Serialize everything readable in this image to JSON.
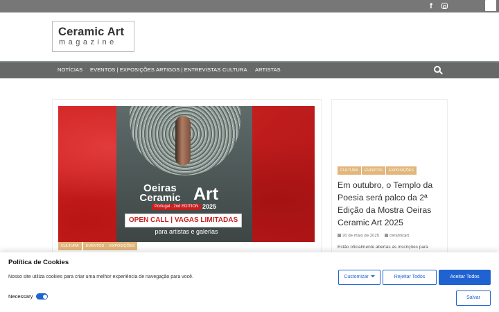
{
  "topbar": {
    "social": [
      "facebook-icon",
      "instagram-icon"
    ]
  },
  "logo": {
    "line1": "Ceramic Art",
    "line2": "magazine"
  },
  "nav": {
    "items": [
      "NOTÍCIAS",
      "EVENTOS | EXPOSIÇÕES",
      "ARTIGOS | ENTREVISTAS",
      "CULTURA",
      "ARTISTAS"
    ],
    "search_icon": "search-icon"
  },
  "hero": {
    "line1": "Oeiras",
    "line2": "Ceramic",
    "line3": "Art",
    "edition": "Portugal . 2nd EDITION",
    "year": "2025",
    "callout": "OPEN CALL | VAGAS LIMITADAS",
    "subline": "para artistas e galerias"
  },
  "main_tags": [
    "CULTURA",
    "EVENTOS",
    "EXPOSIÇÕES"
  ],
  "side_post": {
    "tags": [
      "CULTURA",
      "EVENTOS",
      "EXPOSIÇÕES"
    ],
    "title": "Em outubro, o Templo da Poesia será palco da 2ª Edição da Mostra Oeiras Ceramic Art 2025",
    "date": "30 de maio de 2025",
    "author": "ceramicart",
    "excerpt": "Estão oficialmente abertas as inscrições para"
  },
  "cookie": {
    "title": "Política de Cookies",
    "description": "Nosso site utiliza cookies para criar uma melhor experiência de navegação para você.",
    "necessary_label": "Necessary",
    "necessary_enabled": true,
    "customize": "Customizar",
    "reject": "Rejeitar Todos",
    "accept": "Aceitar Todos",
    "save": "Salvar"
  },
  "colors": {
    "nav_bg": "#656a69",
    "tag_bg": "#e2b77c",
    "cookie_accent": "#1e63d1",
    "topbar_bg": "#777777"
  }
}
